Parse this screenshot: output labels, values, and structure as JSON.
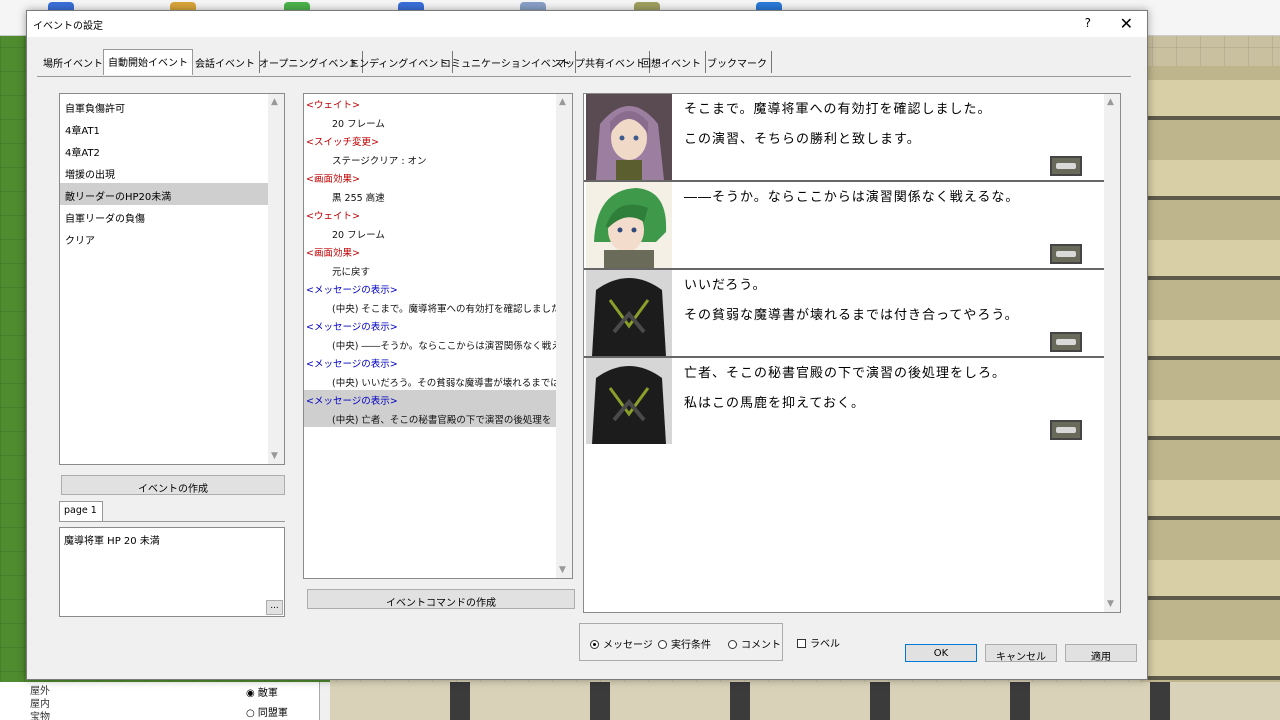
{
  "dialog": {
    "title": "イベントの設定",
    "help": "?",
    "close": "✕"
  },
  "tabs": [
    {
      "label": "場所イベント",
      "active": false
    },
    {
      "label": "自動開始イベント",
      "active": true
    },
    {
      "label": "会話イベント",
      "active": false
    },
    {
      "label": "オープニングイベント",
      "active": false
    },
    {
      "label": "エンディングイベント",
      "active": false
    },
    {
      "label": "コミュニケーションイベント",
      "active": false
    },
    {
      "label": "マップ共有イベント",
      "active": false
    },
    {
      "label": "回想イベント",
      "active": false
    },
    {
      "label": "ブックマーク",
      "active": false
    }
  ],
  "event_list": {
    "items": [
      {
        "label": "自軍負傷許可",
        "selected": false
      },
      {
        "label": "4章AT1",
        "selected": false
      },
      {
        "label": "4章AT2",
        "selected": false
      },
      {
        "label": "増援の出現",
        "selected": false
      },
      {
        "label": "敵リーダーのHP20未満",
        "selected": true
      },
      {
        "label": "自軍リーダの負傷",
        "selected": false
      },
      {
        "label": "クリア",
        "selected": false
      }
    ],
    "create_button": "イベントの作成"
  },
  "page_tab": "page 1",
  "condition_text": "魔導将軍 HP 20 未満",
  "ellipsis_button": "...",
  "commands": {
    "items": [
      {
        "text": "<ウェイト>",
        "kind": "head",
        "color": "#c00000",
        "selected": false
      },
      {
        "text": "20 フレーム",
        "kind": "body",
        "color": "#111111",
        "selected": false
      },
      {
        "text": "<スイッチ変更>",
        "kind": "head",
        "color": "#c00000",
        "selected": false
      },
      {
        "text": "ステージクリア : オン",
        "kind": "body",
        "color": "#111111",
        "selected": false
      },
      {
        "text": "<画面効果>",
        "kind": "head",
        "color": "#c00000",
        "selected": false
      },
      {
        "text": "黒 255 高速",
        "kind": "body",
        "color": "#111111",
        "selected": false
      },
      {
        "text": "<ウェイト>",
        "kind": "head",
        "color": "#c00000",
        "selected": false
      },
      {
        "text": "20 フレーム",
        "kind": "body",
        "color": "#111111",
        "selected": false
      },
      {
        "text": "<画面効果>",
        "kind": "head",
        "color": "#c00000",
        "selected": false
      },
      {
        "text": "元に戻す",
        "kind": "body",
        "color": "#111111",
        "selected": false
      },
      {
        "text": "<メッセージの表示>",
        "kind": "head",
        "color": "#0000c0",
        "selected": false
      },
      {
        "text": "(中央) そこまで。魔導将軍への有効打を確認しました",
        "kind": "body",
        "color": "#111111",
        "selected": false
      },
      {
        "text": "<メッセージの表示>",
        "kind": "head",
        "color": "#0000c0",
        "selected": false
      },
      {
        "text": "(中央) ――そうか。ならここからは演習関係なく戦える",
        "kind": "body",
        "color": "#111111",
        "selected": false
      },
      {
        "text": "<メッセージの表示>",
        "kind": "head",
        "color": "#0000c0",
        "selected": false
      },
      {
        "text": "(中央) いいだろう。その貧弱な魔導書が壊れるまでは",
        "kind": "body",
        "color": "#111111",
        "selected": false
      },
      {
        "text": "<メッセージの表示>",
        "kind": "head",
        "color": "#0000c0",
        "selected": true
      },
      {
        "text": "(中央) 亡者、そこの秘書官殿の下で演習の後処理を",
        "kind": "body",
        "color": "#111111",
        "selected": true
      }
    ],
    "create_button": "イベントコマンドの作成"
  },
  "preview": {
    "messages": [
      {
        "face": "purple-hair-woman",
        "lines": [
          "そこまで。魔導将軍への有効打を確認しました。",
          "この演習、そちらの勝利と致します。"
        ]
      },
      {
        "face": "green-hair-man",
        "lines": [
          "――そうか。ならここからは演習関係なく戦えるな。"
        ]
      },
      {
        "face": "dark-armored-knight",
        "lines": [
          "いいだろう。",
          "その貧弱な魔導書が壊れるまでは付き合ってやろう。"
        ]
      },
      {
        "face": "dark-armored-knight",
        "lines": [
          "亡者、そこの秘書官殿の下で演習の後処理をしろ。",
          "私はこの馬鹿を抑えておく。"
        ]
      }
    ]
  },
  "view_options": {
    "radios": [
      {
        "label": "メッセージ",
        "checked": true
      },
      {
        "label": "実行条件",
        "checked": false
      },
      {
        "label": "コメント",
        "checked": false
      }
    ],
    "label_checkbox": "ラベル"
  },
  "footer": {
    "ok": "OK",
    "cancel": "キャンセル",
    "apply": "適用"
  },
  "background": {
    "tree_items": [
      "屋外",
      "屋内",
      "宝物"
    ],
    "radios": [
      {
        "label": "敵軍",
        "checked": true
      },
      {
        "label": "同盟軍",
        "checked": false
      }
    ]
  }
}
